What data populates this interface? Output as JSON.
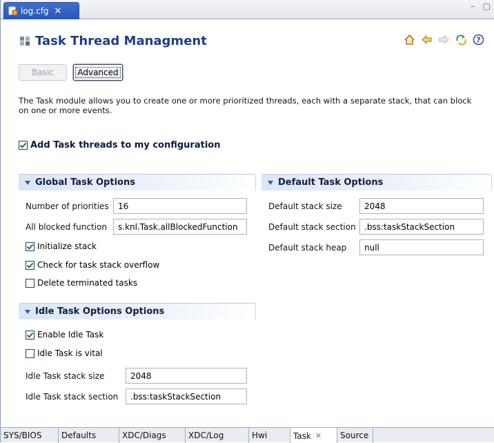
{
  "window": {
    "tab_title": "log.cfg",
    "tab_close": "✕",
    "controls": "– ▢"
  },
  "header": {
    "title": "Task Thread Managment"
  },
  "modes": {
    "basic": "Basic",
    "advanced": "Advanced"
  },
  "description": "The Task module allows you to create one or more prioritized threads, each with a separate stack, that can block on one or more events.",
  "main_check": {
    "label": "Add Task threads to my configuration",
    "checked": true
  },
  "global": {
    "header": "Global Task Options",
    "num_priorities_label": "Number of priorities",
    "num_priorities_value": "16",
    "all_blocked_label": "All blocked function",
    "all_blocked_value": "s.knl.Task.allBlockedFunction",
    "init_stack_label": "Initialize stack",
    "init_stack_checked": true,
    "check_overflow_label": "Check for task stack overflow",
    "check_overflow_checked": true,
    "delete_terminated_label": "Delete terminated tasks",
    "delete_terminated_checked": false
  },
  "defaults": {
    "header": "Default Task Options",
    "stack_size_label": "Default stack size",
    "stack_size_value": "2048",
    "stack_section_label": "Default stack section",
    "stack_section_value": ".bss:taskStackSection",
    "stack_heap_label": "Default stack heap",
    "stack_heap_value": "null"
  },
  "idle": {
    "header": "Idle Task Options Options",
    "enable_label": "Enable Idle Task",
    "enable_checked": true,
    "vital_label": "Idle Task is vital",
    "vital_checked": false,
    "stack_size_label": "Idle Task stack size",
    "stack_size_value": "2048",
    "stack_section_label": "Idle Task stack section",
    "stack_section_value": ".bss:taskStackSection"
  },
  "bottom_tabs": [
    {
      "label": "SYS/BIOS"
    },
    {
      "label": "Defaults"
    },
    {
      "label": "XDC/Diags"
    },
    {
      "label": "XDC/Log"
    },
    {
      "label": "Hwi"
    },
    {
      "label": "Task",
      "close": "✕"
    },
    {
      "label": "Source"
    }
  ],
  "icons": {
    "file": "config-file-icon",
    "header": "task-module-icon",
    "home": "home-icon",
    "back": "back-arrow-icon",
    "forward": "forward-arrow-icon",
    "refresh": "refresh-icon",
    "help": "help-icon"
  },
  "colors": {
    "title": "#1d3f82",
    "tab_active": "#2a56b8",
    "section_bg": "#dbe6f5"
  }
}
